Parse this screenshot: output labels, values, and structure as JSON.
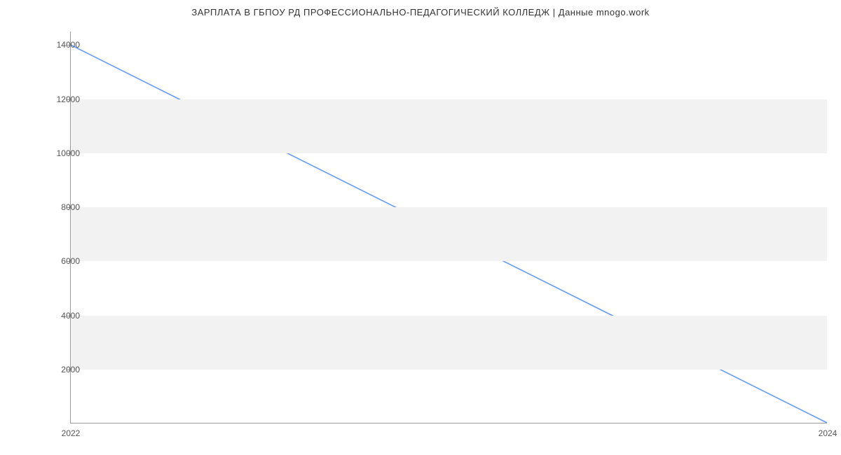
{
  "chart_data": {
    "type": "line",
    "title": "ЗАРПЛАТА В ГБПОУ  РД ПРОФЕССИОНАЛЬНО-ПЕДАГОГИЧЕСКИЙ КОЛЛЕДЖ | Данные mnogo.work",
    "x": [
      2022,
      2024
    ],
    "values": [
      14000,
      0
    ],
    "xlabel": "",
    "ylabel": "",
    "x_ticks": [
      2022,
      2024
    ],
    "y_ticks": [
      2000,
      4000,
      6000,
      8000,
      10000,
      12000,
      14000
    ],
    "ylim": [
      0,
      14500
    ],
    "xlim": [
      2022,
      2024
    ],
    "line_color": "#6699ff",
    "bands": [
      {
        "from": 2000,
        "to": 4000
      },
      {
        "from": 6000,
        "to": 8000
      },
      {
        "from": 10000,
        "to": 12000
      }
    ]
  }
}
